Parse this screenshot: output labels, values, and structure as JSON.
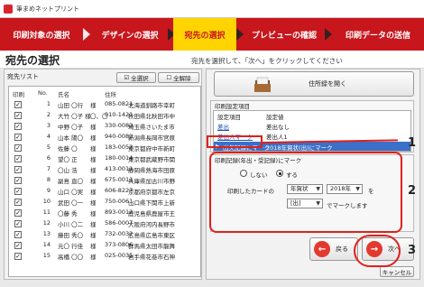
{
  "window": {
    "title": "筆まめネットプリント"
  },
  "steps": [
    {
      "label": "印刷対象の選択"
    },
    {
      "label": "デザインの選択"
    },
    {
      "label": "宛先の選択"
    },
    {
      "label": "プレビューの確認"
    },
    {
      "label": "印刷データの送信"
    }
  ],
  "heading": {
    "title": "宛先の選択",
    "instruction": "宛先を選択して、「次へ」をクリックしてください"
  },
  "address_list": {
    "title": "宛先リスト",
    "select_all_label": "全選択",
    "clear_all_label": "全解除",
    "columns": {
      "print": "印刷",
      "no": "No.",
      "name": "氏名",
      "address": "住所"
    },
    "rows": [
      {
        "checked": "✓",
        "no": "1",
        "name": "山田 〇行",
        "honorific": "様",
        "zip": "085-0821",
        "address": "北海道釧路市幸町"
      },
      {
        "checked": "✓",
        "no": "2",
        "name": "大竹 〇子 様",
        "honorific": "〇、〇",
        "zip": "010-1421",
        "address": "秋田県北秋田市中"
      },
      {
        "checked": "✓",
        "no": "3",
        "name": "中野 〇子",
        "honorific": "様",
        "zip": "330-0083",
        "address": "埼玉県さいたま市"
      },
      {
        "checked": "✓",
        "no": "4",
        "name": "山本 陽〇",
        "honorific": "様",
        "zip": "940-0083",
        "address": "新潟県長岡市宮原"
      },
      {
        "checked": "✓",
        "no": "5",
        "name": "佐藤 〇",
        "honorific": "様",
        "zip": "183-0052",
        "address": "東京都府中市新町"
      },
      {
        "checked": "✓",
        "no": "6",
        "name": "望〇 正",
        "honorific": "様",
        "zip": "180-0014",
        "address": "東京都武蔵野市関"
      },
      {
        "checked": "✓",
        "no": "7",
        "name": "〇山 浩",
        "honorific": "様",
        "zip": "413-0011",
        "address": "静岡県熱海市田原"
      },
      {
        "checked": "✓",
        "no": "8",
        "name": "副島 直〇",
        "honorific": "様",
        "zip": "675-0011",
        "address": "兵庫県加古川市野"
      },
      {
        "checked": "✓",
        "no": "9",
        "name": "山口 〇実",
        "honorific": "様",
        "zip": "606-8227",
        "address": "京都府京都市左京"
      },
      {
        "checked": "✓",
        "no": "10",
        "name": "武田 〇一",
        "honorific": "様",
        "zip": "750-0061",
        "address": "山口県下関市上新"
      },
      {
        "checked": "✓",
        "no": "11",
        "name": "〇藤 秀",
        "honorific": "様",
        "zip": "893-0012",
        "address": "鹿児島県鹿屋市王"
      },
      {
        "checked": "✓",
        "no": "12",
        "name": "小川 〇二",
        "honorific": "様",
        "zip": "586-0007",
        "address": "大阪府河内長野市"
      },
      {
        "checked": "✓",
        "no": "13",
        "name": "藤田 秀〇",
        "honorific": "様",
        "zip": "732-0032",
        "address": "広島県広島市東区"
      },
      {
        "checked": "✓",
        "no": "14",
        "name": "元〇 行佳",
        "honorific": "様",
        "zip": "373-0806",
        "address": "群馬県太田市龍舞"
      },
      {
        "checked": "✓",
        "no": "15",
        "name": "高橋 〇〇",
        "honorific": "様",
        "zip": "025-0035",
        "address": "岩手県花巻市石神"
      }
    ]
  },
  "history_button": {
    "label": "住所録を開く"
  },
  "print_settings": {
    "group_label": "印刷設定項目",
    "col_item": "設定項目",
    "col_value": "設定値",
    "rows": [
      {
        "item": "差出",
        "value": "差出なし"
      },
      {
        "item": "差出人マーク",
        "value": "差出人1"
      },
      {
        "item": "出欠記録にマーク",
        "value": "2018年賀状(出)にマーク"
      }
    ]
  },
  "mark_settings": {
    "group_label": "印刷記録(年出・受記録)にマーク",
    "option_no": "しない",
    "option_yes": "する",
    "card_prefix": "印刷したカードの",
    "select_type": "年賀状",
    "select_year": "2018年",
    "particle": "を",
    "select_io": "[出]",
    "suffix": "でマークします"
  },
  "buttons": {
    "back_label": "戻る",
    "next_label": "次へ",
    "cancel_label": "キャンセル"
  },
  "callouts": [
    "1",
    "2",
    "3"
  ],
  "colors": {
    "step_bar": "#c8161d",
    "step_active": "#ffd400",
    "callout": "#e0211a"
  }
}
